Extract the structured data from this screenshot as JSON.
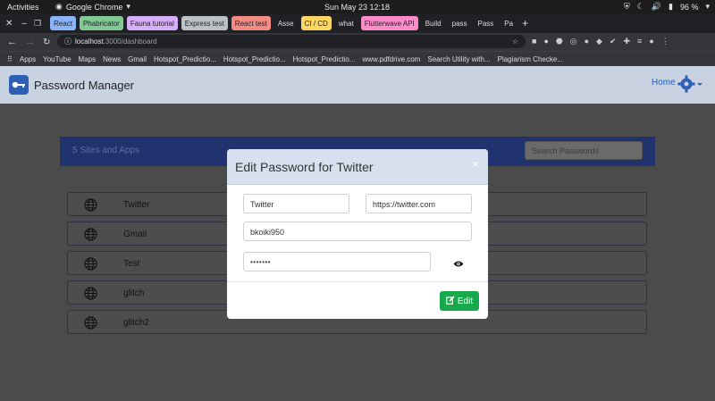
{
  "os": {
    "activities": "Activities",
    "app_name": "Google Chrome",
    "clock": "Sun May 23  12:18",
    "battery": "96 %"
  },
  "browser": {
    "tabs": [
      {
        "label": "React",
        "color": "#8ab4f8"
      },
      {
        "label": "Phabricator",
        "color": "#81c995"
      },
      {
        "label": "Fauna tutorial",
        "color": "#d7aefb"
      },
      {
        "label": "Express test",
        "color": "#bdc1c6"
      },
      {
        "label": "React test",
        "color": "#f28b82"
      },
      {
        "label": "Asse",
        "color": ""
      },
      {
        "label": "CI / CD",
        "color": "#fdd663"
      },
      {
        "label": "what",
        "color": ""
      },
      {
        "label": "Flutterwave API",
        "color": "#ff8bcb"
      },
      {
        "label": "Build",
        "color": ""
      },
      {
        "label": "pass",
        "color": ""
      },
      {
        "label": "Pass",
        "color": ""
      },
      {
        "label": "Pa",
        "color": ""
      }
    ],
    "url_host": "localhost",
    "url_path": ":3000/dashboard",
    "bookmarks": [
      "Apps",
      "YouTube",
      "Maps",
      "News",
      "Gmail",
      "Hotspot_Predictio...",
      "Hotspot_Predictio...",
      "Hotspot_Predictio...",
      "www.pdfdrive.com",
      "Search Utility with...",
      "Plagiarism Checke..."
    ]
  },
  "app": {
    "brand": "Password Manager",
    "nav_home": "Home",
    "panel_title": "5 Sites and Apps",
    "search_placeholder": "Search Passwords",
    "sites": [
      "Twitter",
      "Gmail",
      "Test",
      "glitch",
      "glitch2"
    ]
  },
  "modal": {
    "title": "Edit Password for Twitter",
    "close": "×",
    "site_name": "Twitter",
    "site_url": "https://twitter.com",
    "username": "bkoiki950",
    "password_masked": "•••••••",
    "edit_label": "Edit"
  },
  "colors": {
    "primary": "#2f5fb3",
    "success": "#17a94c",
    "navbar": "#c9d2e0",
    "panel": "#20336e"
  }
}
